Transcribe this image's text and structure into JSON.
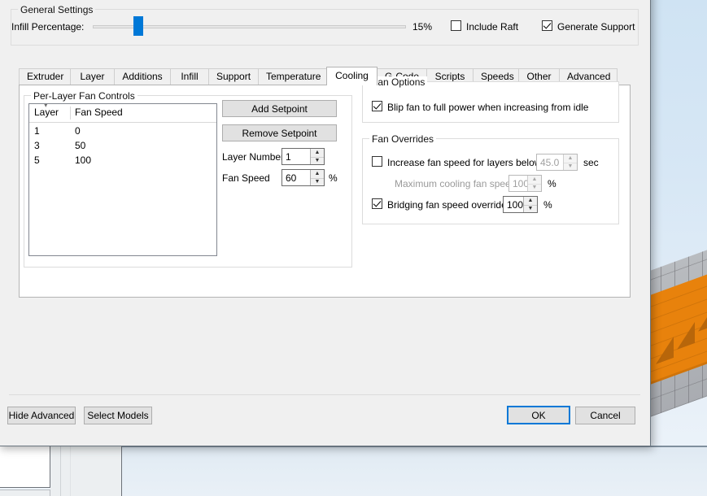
{
  "dialog": {
    "general_settings": {
      "legend": "General Settings",
      "infill_label": "Infill Percentage:",
      "infill_value": "15%",
      "infill_percent": 15,
      "include_raft": {
        "label": "Include Raft",
        "checked": false
      },
      "generate_support": {
        "label": "Generate Support",
        "checked": true
      }
    },
    "tabs": [
      {
        "label": "Extruder",
        "active": false
      },
      {
        "label": "Layer",
        "active": false
      },
      {
        "label": "Additions",
        "active": false
      },
      {
        "label": "Infill",
        "active": false
      },
      {
        "label": "Support",
        "active": false
      },
      {
        "label": "Temperature",
        "active": false
      },
      {
        "label": "Cooling",
        "active": true
      },
      {
        "label": "G-Code",
        "active": false
      },
      {
        "label": "Scripts",
        "active": false
      },
      {
        "label": "Speeds",
        "active": false
      },
      {
        "label": "Other",
        "active": false
      },
      {
        "label": "Advanced",
        "active": false
      }
    ],
    "cooling": {
      "per_layer": {
        "legend": "Per-Layer Fan Controls",
        "columns": [
          "Layer",
          "Fan Speed"
        ],
        "rows": [
          {
            "layer": "1",
            "fan_speed": "0"
          },
          {
            "layer": "3",
            "fan_speed": "50"
          },
          {
            "layer": "5",
            "fan_speed": "100"
          }
        ],
        "add_setpoint": "Add Setpoint",
        "remove_setpoint": "Remove Setpoint",
        "layer_number_label": "Layer Number",
        "layer_number_value": "1",
        "fan_speed_label": "Fan Speed",
        "fan_speed_value": "60",
        "fan_speed_unit": "%"
      },
      "fan_options": {
        "legend": "Fan Options",
        "blip": {
          "label": "Blip fan to full power when increasing from idle",
          "checked": true
        }
      },
      "fan_overrides": {
        "legend": "Fan Overrides",
        "increase_below": {
          "label": "Increase fan speed for layers below",
          "checked": false,
          "value": "45.0",
          "unit": "sec"
        },
        "max_cooling": {
          "label": "Maximum cooling fan speed",
          "value": "100",
          "unit": "%"
        },
        "bridging": {
          "label": "Bridging fan speed override",
          "checked": true,
          "value": "100",
          "unit": "%"
        }
      }
    },
    "footer": {
      "hide_advanced": "Hide Advanced",
      "select_models": "Select Models",
      "ok": "OK",
      "cancel": "Cancel"
    }
  },
  "colors": {
    "accent": "#0078d7",
    "model": "#e8820c",
    "model_shadow": "#b8660a",
    "dialog_bg": "#f0f0f0",
    "viewport_top": "#cfe3f3"
  }
}
